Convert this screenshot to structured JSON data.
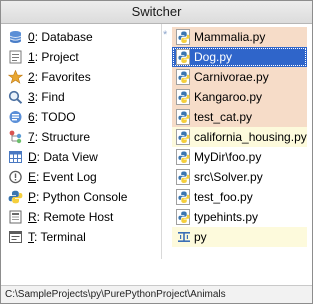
{
  "window": {
    "title": "Switcher"
  },
  "tool_windows": [
    {
      "mnemonic": "0",
      "label": ": Database",
      "icon": "database-icon"
    },
    {
      "mnemonic": "1",
      "label": ": Project",
      "icon": "project-folder-icon"
    },
    {
      "mnemonic": "2",
      "label": ": Favorites",
      "icon": "star-icon"
    },
    {
      "mnemonic": "3",
      "label": ": Find",
      "icon": "find-icon"
    },
    {
      "mnemonic": "6",
      "label": ": TODO",
      "icon": "todo-icon"
    },
    {
      "mnemonic": "7",
      "label": ": Structure",
      "icon": "structure-icon"
    },
    {
      "mnemonic": "D",
      "label": ": Data View",
      "icon": "data-view-icon"
    },
    {
      "mnemonic": "E",
      "label": ": Event Log",
      "icon": "event-log-icon"
    },
    {
      "mnemonic": "P",
      "label": ": Python Console",
      "icon": "python-console-icon"
    },
    {
      "mnemonic": "R",
      "label": ": Remote Host",
      "icon": "remote-host-icon"
    },
    {
      "mnemonic": "T",
      "label": ": Terminal",
      "icon": "terminal-icon"
    }
  ],
  "files": [
    {
      "label": "Mammalia.py",
      "icon": "python-file-icon",
      "state": "pinned",
      "marker": "*"
    },
    {
      "label": "Dog.py",
      "icon": "python-file-icon",
      "state": "selected"
    },
    {
      "label": "Carnivorae.py",
      "icon": "python-file-icon",
      "state": "pinned"
    },
    {
      "label": "Kangaroo.py",
      "icon": "python-file-icon",
      "state": "pinned"
    },
    {
      "label": "test_cat.py",
      "icon": "python-file-icon",
      "state": "pinned"
    },
    {
      "label": "california_housing.py",
      "icon": "python-file-icon",
      "state": "modified"
    },
    {
      "label": "MyDir\\foo.py",
      "icon": "python-file-icon",
      "state": "normal"
    },
    {
      "label": "src\\Solver.py",
      "icon": "python-file-icon",
      "state": "normal"
    },
    {
      "label": "test_foo.py",
      "icon": "python-file-icon",
      "state": "normal"
    },
    {
      "label": "typehints.py",
      "icon": "python-file-icon",
      "state": "normal"
    },
    {
      "label": "py",
      "icon": "text-file-icon",
      "state": "modified"
    }
  ],
  "status_path": "C:\\SampleProjects\\py\\PurePythonProject\\Animals",
  "colors": {
    "selection": "#2f65ca",
    "pinned_bg": "#f6dcc8",
    "modified_bg": "#fdfadc",
    "python_blue": "#3a75b0",
    "python_yellow": "#f5cf3c"
  }
}
